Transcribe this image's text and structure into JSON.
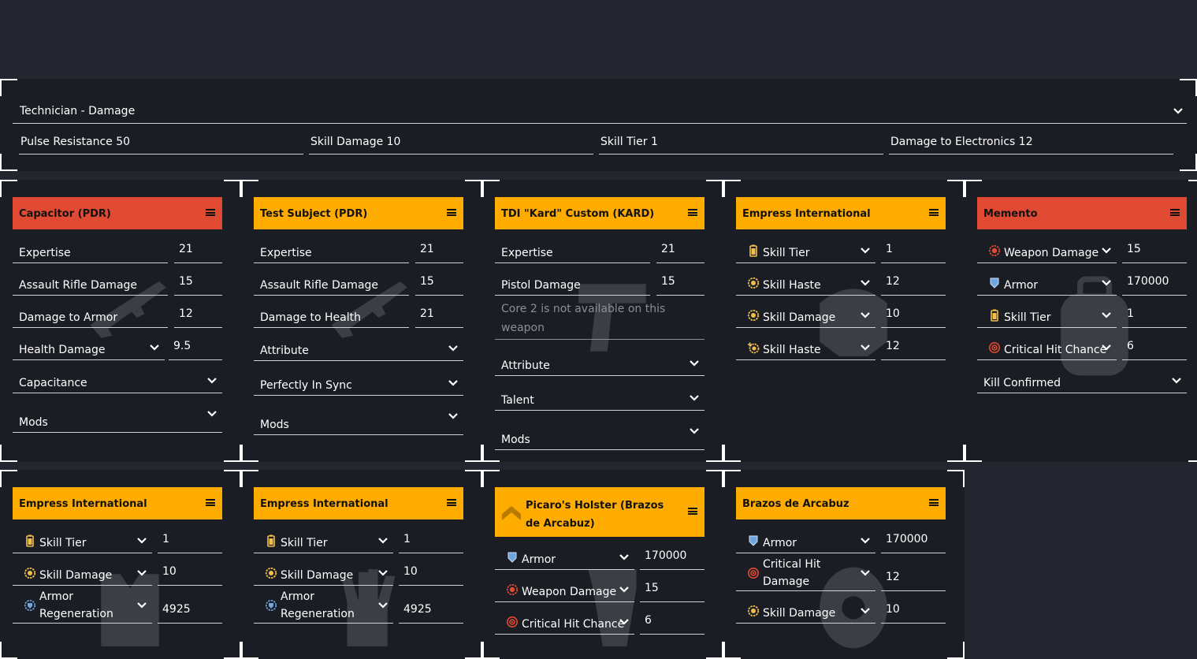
{
  "build": {
    "selected": "Technician - Damage",
    "stats": [
      "Pulse Resistance 50",
      "Skill Damage 10",
      "Skill Tier 1",
      "Damage to Electronics 12"
    ]
  },
  "cards": [
    {
      "title": "Capacitor (PDR)",
      "header_color": "#e04a32",
      "rows": [
        {
          "label": "Expertise",
          "value": "21"
        },
        {
          "label": "Assault Rifle Damage",
          "value": "15"
        },
        {
          "label": "Damage to Armor",
          "value": "12"
        },
        {
          "label": "Health Damage",
          "value": "9.5"
        }
      ],
      "selects": [
        "Capacitance",
        "Mods"
      ]
    },
    {
      "title": "Test Subject (PDR)",
      "header_color": "#ffac00",
      "rows": [
        {
          "label": "Expertise",
          "value": "21"
        },
        {
          "label": "Assault Rifle Damage",
          "value": "15"
        },
        {
          "label": "Damage to Health",
          "value": "21"
        }
      ],
      "selects": [
        "Attribute",
        "Perfectly In Sync",
        "Mods"
      ]
    },
    {
      "title": "TDI \"Kard\" Custom (KARD)",
      "header_color": "#ffac00",
      "rows": [
        {
          "label": "Expertise",
          "value": "21"
        },
        {
          "label": "Pistol Damage",
          "value": "15"
        }
      ],
      "disabled_note": "Core 2 is not available on this weapon",
      "selects": [
        "Attribute",
        "Talent",
        "Mods"
      ]
    },
    {
      "title": "Empress International",
      "header_color": "#ffac00",
      "rows": [
        {
          "label": "Skill Tier",
          "value": "1",
          "icon": "battery-icon"
        },
        {
          "label": "Skill Haste",
          "value": "12",
          "icon": "gear-icon"
        },
        {
          "label": "Skill Damage",
          "value": "10",
          "icon": "gear-icon"
        },
        {
          "label": "Skill Haste",
          "value": "12",
          "icon": "gear-plus-icon"
        }
      ]
    },
    {
      "title": "Memento",
      "header_color": "#e04a32",
      "rows": [
        {
          "label": "Weapon Damage",
          "value": "15",
          "icon": "weapon-damage-icon"
        },
        {
          "label": "Armor",
          "value": "170000",
          "icon": "shield-icon"
        },
        {
          "label": "Skill Tier",
          "value": "1",
          "icon": "battery-icon"
        },
        {
          "label": "Critical Hit Chance",
          "value": "6",
          "icon": "crit-icon"
        }
      ],
      "selects": [
        "Kill Confirmed"
      ]
    },
    {
      "title": "Empress International",
      "header_color": "#ffac00",
      "rows": [
        {
          "label": "Skill Tier",
          "value": "1",
          "icon": "battery-icon"
        },
        {
          "label": "Skill Damage",
          "value": "10",
          "icon": "gear-icon"
        },
        {
          "label": "Armor\nRegeneration",
          "value": "4925",
          "icon": "armor-regen-icon"
        }
      ]
    },
    {
      "title": "Empress International",
      "header_color": "#ffac00",
      "rows": [
        {
          "label": "Skill Tier",
          "value": "1",
          "icon": "battery-icon"
        },
        {
          "label": "Skill Damage",
          "value": "10",
          "icon": "gear-icon"
        },
        {
          "label": "Armor\nRegeneration",
          "value": "4925",
          "icon": "armor-regen-icon"
        }
      ]
    },
    {
      "title": "Picaro's Holster (Brazos de Arcabuz)",
      "header_color": "#ffac00",
      "rows": [
        {
          "label": "Armor",
          "value": "170000",
          "icon": "shield-icon"
        },
        {
          "label": "Weapon Damage",
          "value": "15",
          "icon": "weapon-damage-icon"
        },
        {
          "label": "Critical Hit Chance",
          "value": "6",
          "icon": "crit-icon"
        }
      ]
    },
    {
      "title": "Brazos de Arcabuz",
      "header_color": "#ffac00",
      "rows": [
        {
          "label": "Armor",
          "value": "170000",
          "icon": "shield-icon"
        },
        {
          "label": "Critical Hit\nDamage",
          "value": "12",
          "icon": "crit-icon"
        },
        {
          "label": "Skill Damage",
          "value": "10",
          "icon": "gear-icon"
        }
      ]
    }
  ],
  "colors": {
    "background": "#23262f",
    "panel": "#1b1d24",
    "exotic_red": "#e04a32",
    "named_yellow": "#ffac00",
    "offense_red": "#e04a32",
    "defense_blue": "#6fa6e0",
    "skill_yellow": "#f1c04a"
  }
}
